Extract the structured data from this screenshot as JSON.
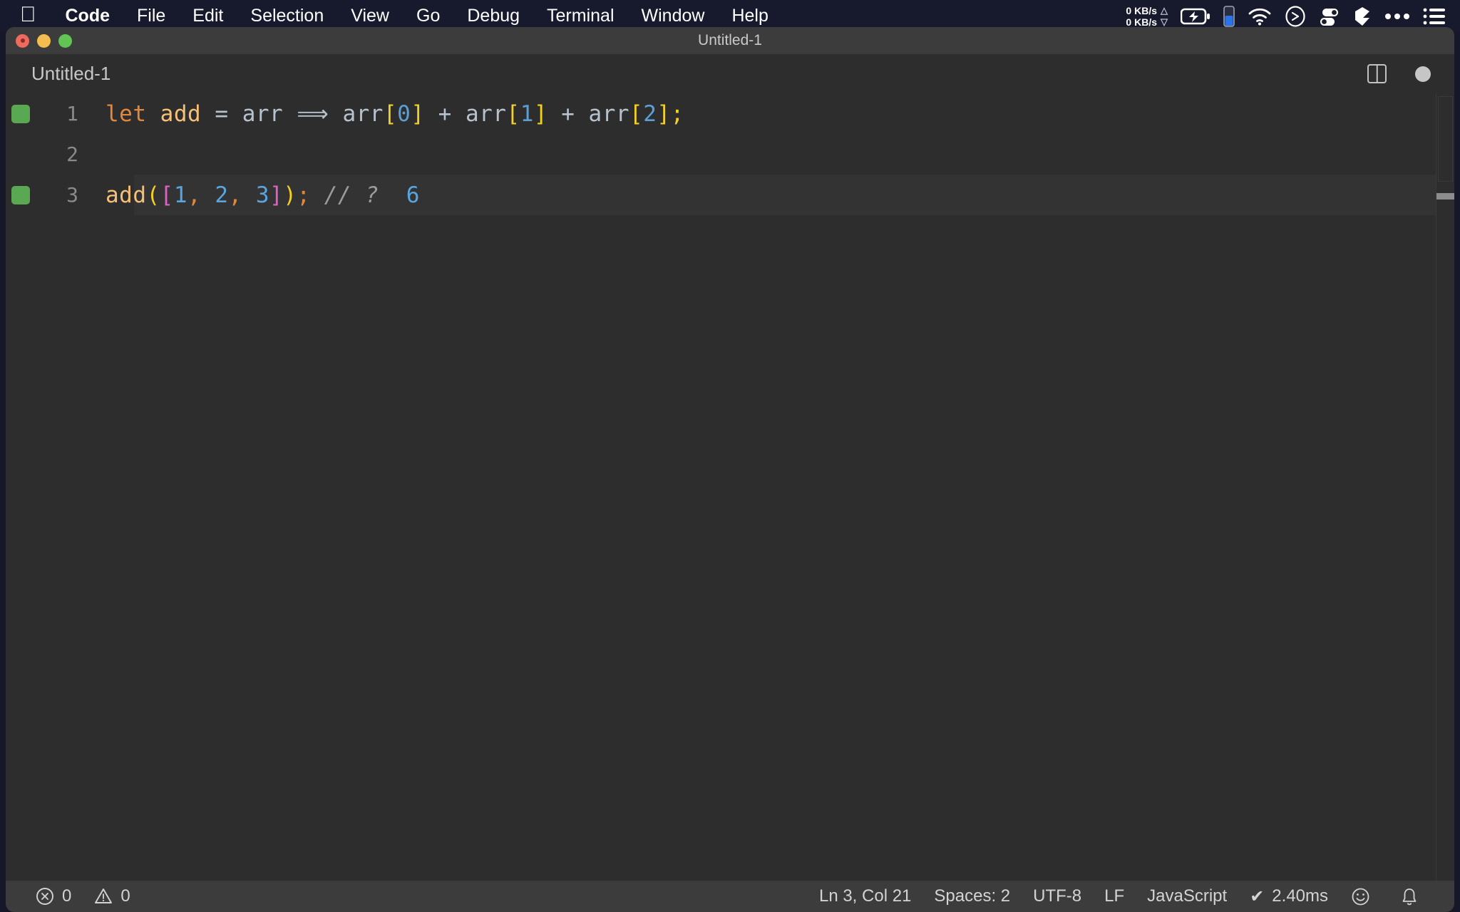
{
  "menubar": {
    "apple_icon": "apple-logo",
    "items": [
      {
        "label": "Code",
        "bold": true
      },
      {
        "label": "File"
      },
      {
        "label": "Edit"
      },
      {
        "label": "Selection"
      },
      {
        "label": "View"
      },
      {
        "label": "Go"
      },
      {
        "label": "Debug"
      },
      {
        "label": "Terminal"
      },
      {
        "label": "Window"
      },
      {
        "label": "Help"
      }
    ],
    "network": {
      "up": "0 KB/s",
      "down": "0 KB/s",
      "up_arrow": "△",
      "down_arrow": "▽"
    },
    "status_icons": [
      "battery-charging-icon",
      "battery-level-icon",
      "wifi-icon",
      "clock-icon",
      "toggles-icon",
      "shape-icon",
      "ellipsis-icon",
      "list-menu-icon"
    ]
  },
  "window": {
    "title": "Untitled-1",
    "traffic_lights": [
      "close",
      "minimize",
      "zoom"
    ]
  },
  "tabbar": {
    "tab_label": "Untitled-1",
    "split_icon": "split-editor-icon",
    "dirty_icon": "unsaved-dot-icon"
  },
  "editor": {
    "language": "JavaScript",
    "lines": [
      {
        "number": "1",
        "has_gutter_mark": true,
        "active": false,
        "tokens": [
          {
            "text": "let",
            "cls": "t-kw"
          },
          {
            "text": " ",
            "cls": "t-plain"
          },
          {
            "text": "add",
            "cls": "t-var"
          },
          {
            "text": " ",
            "cls": "t-plain"
          },
          {
            "text": "=",
            "cls": "t-op"
          },
          {
            "text": " ",
            "cls": "t-plain"
          },
          {
            "text": "arr",
            "cls": "t-plain"
          },
          {
            "text": " ",
            "cls": "t-plain"
          },
          {
            "text": "⟹",
            "cls": "t-op"
          },
          {
            "text": " ",
            "cls": "t-plain"
          },
          {
            "text": "arr",
            "cls": "t-plain"
          },
          {
            "text": "[",
            "cls": "t-br1"
          },
          {
            "text": "0",
            "cls": "t-num"
          },
          {
            "text": "]",
            "cls": "t-br1"
          },
          {
            "text": " ",
            "cls": "t-plain"
          },
          {
            "text": "+",
            "cls": "t-op"
          },
          {
            "text": " ",
            "cls": "t-plain"
          },
          {
            "text": "arr",
            "cls": "t-plain"
          },
          {
            "text": "[",
            "cls": "t-br1"
          },
          {
            "text": "1",
            "cls": "t-num"
          },
          {
            "text": "]",
            "cls": "t-br1"
          },
          {
            "text": " ",
            "cls": "t-plain"
          },
          {
            "text": "+",
            "cls": "t-op"
          },
          {
            "text": " ",
            "cls": "t-plain"
          },
          {
            "text": "arr",
            "cls": "t-plain"
          },
          {
            "text": "[",
            "cls": "t-br1"
          },
          {
            "text": "2",
            "cls": "t-num"
          },
          {
            "text": "]",
            "cls": "t-br1"
          },
          {
            "text": ";",
            "cls": "t-br1"
          }
        ],
        "plain_text": "let add = arr => arr[0] + arr[1] + arr[2];"
      },
      {
        "number": "2",
        "has_gutter_mark": false,
        "active": false,
        "tokens": [],
        "plain_text": ""
      },
      {
        "number": "3",
        "has_gutter_mark": true,
        "active": true,
        "tokens": [
          {
            "text": "add",
            "cls": "t-fn"
          },
          {
            "text": "(",
            "cls": "t-br1"
          },
          {
            "text": "[",
            "cls": "t-br2"
          },
          {
            "text": "1",
            "cls": "t-num2"
          },
          {
            "text": ",",
            "cls": "t-comma"
          },
          {
            "text": " ",
            "cls": "t-plain"
          },
          {
            "text": "2",
            "cls": "t-num2"
          },
          {
            "text": ",",
            "cls": "t-comma"
          },
          {
            "text": " ",
            "cls": "t-plain"
          },
          {
            "text": "3",
            "cls": "t-num2"
          },
          {
            "text": "]",
            "cls": "t-br2"
          },
          {
            "text": ")",
            "cls": "t-br1"
          },
          {
            "text": ";",
            "cls": "t-semi"
          },
          {
            "text": " ",
            "cls": "t-plain"
          },
          {
            "text": "//",
            "cls": "t-comment"
          },
          {
            "text": " ",
            "cls": "t-plain"
          },
          {
            "text": "?",
            "cls": "t-comment"
          },
          {
            "text": "  ",
            "cls": "t-plain"
          },
          {
            "text": "6",
            "cls": "t-num2"
          }
        ],
        "plain_text": "add([1, 2, 3]); // ?  6"
      }
    ]
  },
  "statusbar": {
    "errors": {
      "icon": "error-circle-icon",
      "count": "0"
    },
    "warnings": {
      "icon": "warning-triangle-icon",
      "count": "0"
    },
    "cursor_position": "Ln 3, Col 21",
    "indentation": "Spaces: 2",
    "encoding": "UTF-8",
    "line_ending": "LF",
    "language_mode": "JavaScript",
    "runtime": {
      "check": "✔",
      "label": "2.40ms"
    },
    "feedback_icon": "smiley-icon",
    "notifications_icon": "bell-icon"
  },
  "colors": {
    "menubar_bg": "#171a2c",
    "window_bg": "#2d2d2d",
    "titlebar_bg": "#3c3c3c",
    "statusbar_bg": "#3c3c3c",
    "active_line_bg": "#333333",
    "gutter_mark": "#5aa851",
    "keyword": "#e2883c",
    "function": "#f6c177",
    "number": "#5b9fd4",
    "bracket_level1": "#f2d024",
    "bracket_level2": "#e060c8",
    "comment": "#9b9b9b"
  }
}
